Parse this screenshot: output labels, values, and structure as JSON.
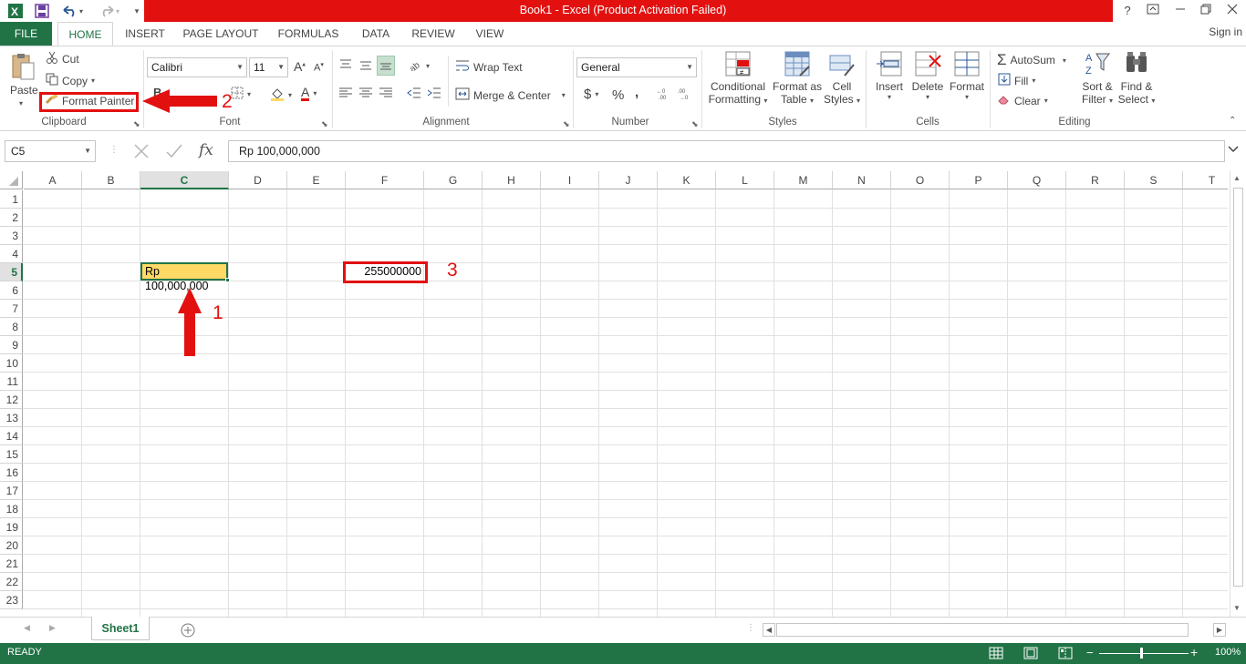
{
  "window": {
    "title": "Book1 -  Excel (Product Activation Failed)",
    "controls": [
      "?",
      "restore-ribbon",
      "minimize",
      "restore",
      "close"
    ]
  },
  "quick_access": {
    "items": [
      "excel-logo-icon",
      "save-icon",
      "undo-icon",
      "redo-icon",
      "customize-qat-icon"
    ]
  },
  "tabs": [
    {
      "label": "FILE"
    },
    {
      "label": "HOME",
      "active": true
    },
    {
      "label": "INSERT"
    },
    {
      "label": "PAGE LAYOUT"
    },
    {
      "label": "FORMULAS"
    },
    {
      "label": "DATA"
    },
    {
      "label": "REVIEW"
    },
    {
      "label": "VIEW"
    }
  ],
  "signin_label": "Sign in",
  "ribbon": {
    "clipboard": {
      "label": "Clipboard",
      "paste": "Paste",
      "cut": "Cut",
      "copy": "Copy",
      "format_painter": "Format Painter"
    },
    "font": {
      "label": "Font",
      "font_name": "Calibri",
      "font_size": "11",
      "grow": "A",
      "shrink": "A",
      "bold": "B",
      "font_color_letter": "A"
    },
    "alignment": {
      "label": "Alignment",
      "wrap_text": "Wrap Text",
      "merge_center": "Merge & Center"
    },
    "number": {
      "label": "Number",
      "format": "General",
      "currency": "$",
      "percent": "%",
      "comma": ","
    },
    "styles": {
      "label": "Styles",
      "conditional_formatting": [
        "Conditional",
        "Formatting"
      ],
      "format_as_table": [
        "Format as",
        "Table"
      ],
      "cell_styles": [
        "Cell",
        "Styles"
      ]
    },
    "cells": {
      "label": "Cells",
      "insert": "Insert",
      "delete": "Delete",
      "format": "Format"
    },
    "editing": {
      "label": "Editing",
      "autosum": "AutoSum",
      "fill": "Fill",
      "clear": "Clear",
      "sort_filter": [
        "Sort &",
        "Filter"
      ],
      "find_select": [
        "Find &",
        "Select"
      ]
    }
  },
  "formula_bar": {
    "name_box": "C5",
    "fx": "fx",
    "content": "Rp 100,000,000"
  },
  "sheet": {
    "columns": [
      "A",
      "B",
      "C",
      "D",
      "E",
      "F",
      "G",
      "H",
      "I",
      "J",
      "K",
      "L",
      "M",
      "N",
      "O",
      "P",
      "Q",
      "R",
      "S",
      "T"
    ],
    "rows": [
      "1",
      "2",
      "3",
      "4",
      "5",
      "6",
      "7",
      "8",
      "9",
      "10",
      "11",
      "12",
      "13",
      "14",
      "15",
      "16",
      "17",
      "18",
      "19",
      "20",
      "21",
      "22",
      "23"
    ],
    "selected_column": "C",
    "selected_row": "5",
    "cells": {
      "C5": "Rp 100,000,000",
      "F5": "255000000"
    },
    "highlight_color": "#ffd966"
  },
  "sheet_tabs": [
    {
      "label": "Sheet1",
      "active": true
    }
  ],
  "status": {
    "mode": "READY",
    "zoom": "100%"
  },
  "annotations": {
    "color": "#e31010",
    "labels": [
      "1",
      "2",
      "3"
    ]
  }
}
